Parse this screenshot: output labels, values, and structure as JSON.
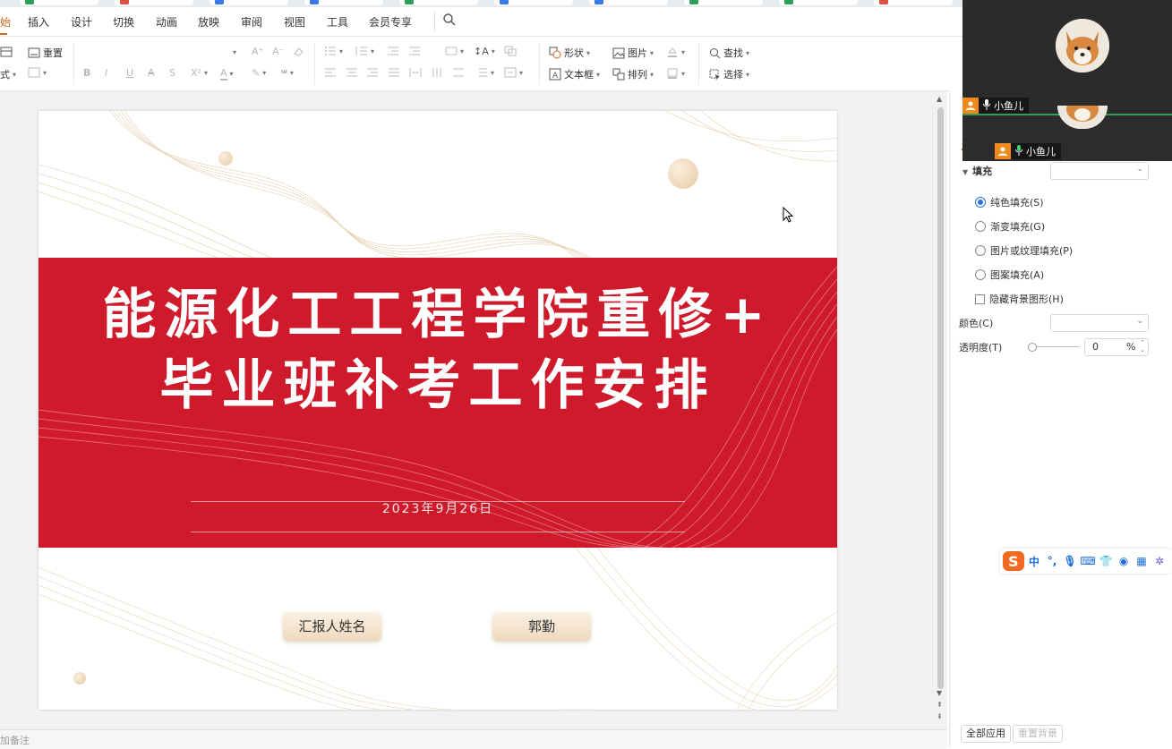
{
  "menu": {
    "items": [
      "始",
      "插入",
      "设计",
      "切换",
      "动画",
      "放映",
      "审阅",
      "视图",
      "工具",
      "会员专享"
    ],
    "active_index": 0
  },
  "ribbon": {
    "reset": "重置",
    "section_caret": "式",
    "shape": "形状",
    "picture": "图片",
    "find": "查找",
    "textbox": "文本框",
    "arrange": "排列",
    "select": "选择"
  },
  "slide": {
    "title_line1": "能源化工工程学院重修+",
    "title_line2": "毕业班补考工作安排",
    "date": "2023年9月26日",
    "reporter_label": "汇报人姓名",
    "reporter_name": "郭勤"
  },
  "notes": {
    "placeholder": "加备注"
  },
  "panel": {
    "tab_label": "填充",
    "section_label": "填充",
    "options": [
      {
        "label": "纯色填充(S)",
        "selected": true
      },
      {
        "label": "渐变填充(G)",
        "selected": false
      },
      {
        "label": "图片或纹理填充(P)",
        "selected": false
      },
      {
        "label": "图案填充(A)",
        "selected": false
      }
    ],
    "hide_bg": "隐藏背景图形(H)",
    "color_label": "颜色(C)",
    "transparency_label": "透明度(T)",
    "transparency_value": "0",
    "transparency_unit": "%",
    "apply_all": "全部应用",
    "reset_bg": "重置背景"
  },
  "video": {
    "participant1": "小鱼儿",
    "participant2": "小鱼儿"
  },
  "ime": {
    "mode": "中"
  },
  "colors": {
    "accent": "#d2691e",
    "slide_red": "#cf1a2b",
    "radio_blue": "#2a6edb",
    "video_bg": "#2b2b2b",
    "badge_orange": "#f08a1c"
  }
}
